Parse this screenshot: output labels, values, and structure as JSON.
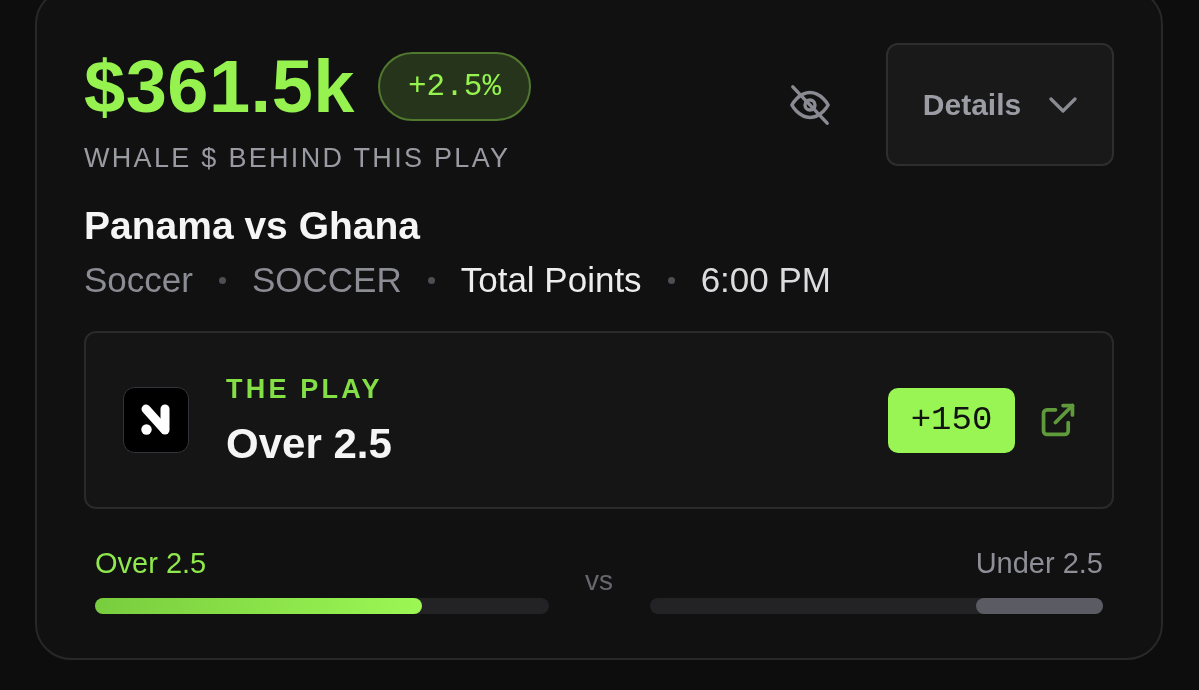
{
  "header": {
    "amount": "$361.5k",
    "change": "+2.5%",
    "caption": "WHALE $ BEHIND THIS PLAY",
    "details_button": {
      "label": "Details",
      "expanded": false
    }
  },
  "match": {
    "title": "Panama vs Ghana",
    "meta": [
      {
        "text": "Soccer",
        "kind": "sport"
      },
      {
        "text": "SOCCER",
        "kind": "league"
      },
      {
        "text": "Total Points",
        "kind": "market"
      },
      {
        "text": "6:00 PM",
        "kind": "time"
      }
    ]
  },
  "play": {
    "label": "THE PLAY",
    "pick": "Over 2.5",
    "odds": "+150"
  },
  "split": {
    "separator": "vs",
    "sides": [
      {
        "label": "Over 2.5",
        "picked": true,
        "level": 0.72
      },
      {
        "label": "Under 2.5",
        "picked": false,
        "level": 0.28
      }
    ]
  }
}
